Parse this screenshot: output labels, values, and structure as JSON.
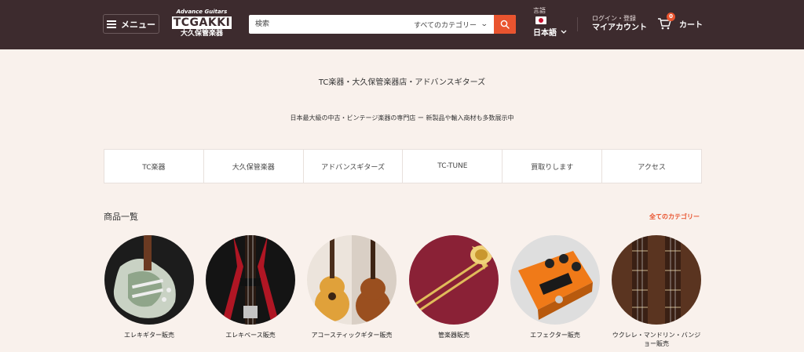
{
  "header": {
    "menu_label": "メニュー",
    "logo": {
      "top": "Advance Guitars",
      "main": "TCGAKKI",
      "sub": "大久保管楽器"
    },
    "search_placeholder": "検索",
    "category_select": "すべてのカテゴリー",
    "language": {
      "label": "言語",
      "value": "日本語"
    },
    "account": {
      "top": "ログイン・登録",
      "main": "マイアカウント"
    },
    "cart": {
      "label": "カート",
      "count": "0"
    }
  },
  "hero": {
    "title": "TC楽器・大久保管楽器店・アドバンスギターズ",
    "subtitle": "日本最大級の中古・ビンテージ楽器の専門店 ー 新製品や輸入商材も多数展示中"
  },
  "nav": [
    {
      "label": "TC楽器"
    },
    {
      "label": "大久保管楽器"
    },
    {
      "label": "アドバンスギターズ"
    },
    {
      "label": "TC-TUNE"
    },
    {
      "label": "買取りします"
    },
    {
      "label": "アクセス"
    }
  ],
  "products": {
    "title": "商品一覧",
    "all_link": "全てのカテゴリー",
    "categories": [
      {
        "label": "エレキギター販売"
      },
      {
        "label": "エレキベース販売"
      },
      {
        "label": "アコースティックギター販売"
      },
      {
        "label": "管楽器販売"
      },
      {
        "label": "エフェクター販売"
      },
      {
        "label": "ウクレレ・マンドリン・バンジョー販売"
      }
    ]
  },
  "colors": {
    "header_bg": "#3d2b2e",
    "accent": "#e9542f",
    "page_bg": "#f9f1ec"
  }
}
